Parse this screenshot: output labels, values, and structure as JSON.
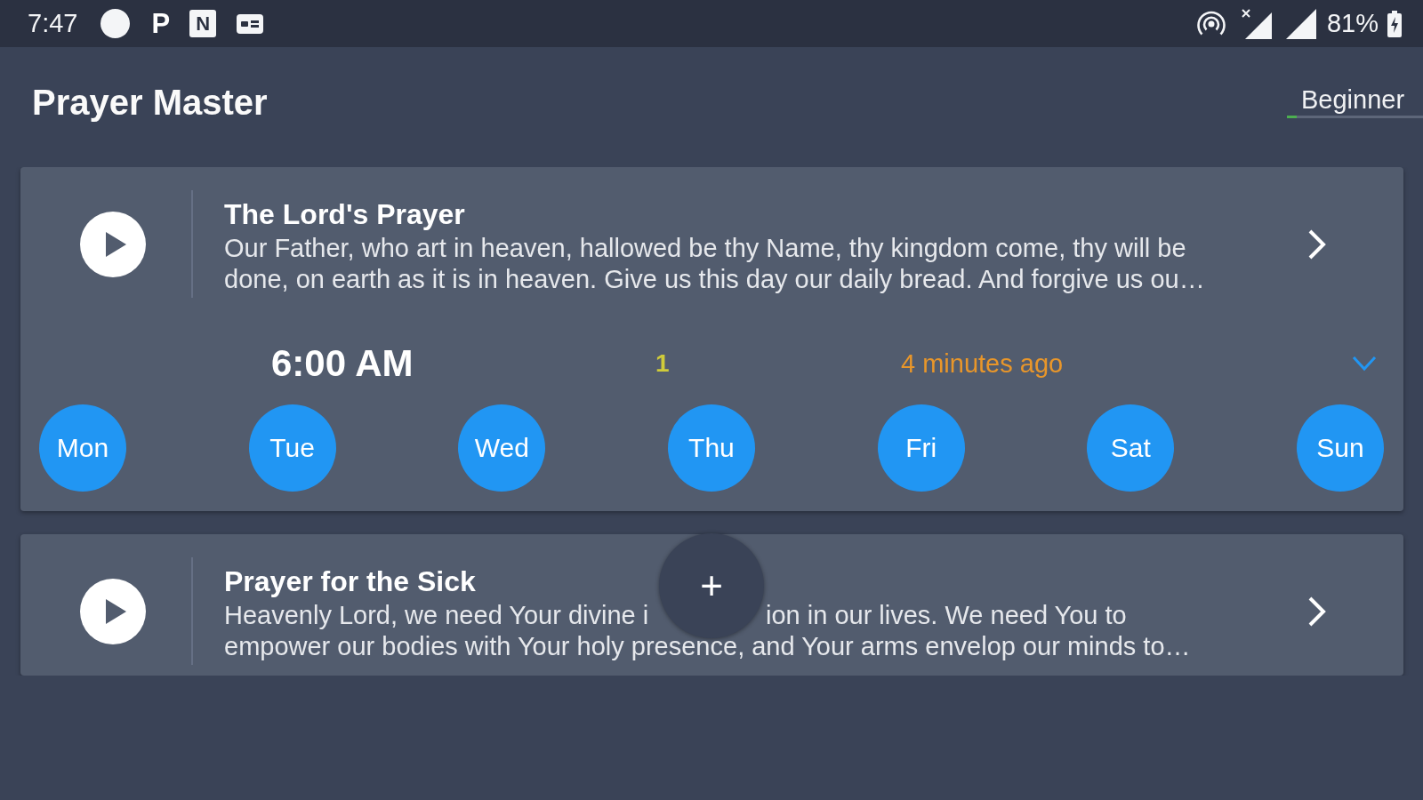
{
  "status_bar": {
    "time": "7:47",
    "notifications": [
      {
        "kind": "letter",
        "text": "P"
      },
      {
        "kind": "tile",
        "text": "N"
      }
    ],
    "battery": "81%"
  },
  "app_bar": {
    "title": "Prayer Master",
    "level_tab": {
      "label": "Beginner",
      "level": 0.07
    }
  },
  "prayers": [
    {
      "title": "The Lord's Prayer",
      "description_lines": [
        [
          "Our Father, who art in heaven, hallowed be thy Name, thy kingdom come, thy will be"
        ],
        [
          "done, on earth as it is in heaven. Give us this day our daily bread. And forgive us ou…"
        ]
      ],
      "schedule": {
        "time": "6:00 AM",
        "count": "1",
        "last_prayed": "4 minutes ago",
        "days": [
          {
            "label": "Mon",
            "selected": true
          },
          {
            "label": "Tue",
            "selected": true
          },
          {
            "label": "Wed",
            "selected": true
          },
          {
            "label": "Thu",
            "selected": true
          },
          {
            "label": "Fri",
            "selected": true
          },
          {
            "label": "Sat",
            "selected": true
          },
          {
            "label": "Sun",
            "selected": true
          }
        ]
      }
    },
    {
      "title": "Prayer for the Sick",
      "description_lines": [
        [
          "Heavenly Lord, we need Your divine i",
          "ion in our lives. We need You to"
        ],
        [
          "empower our bodies with Your holy presence, and Your arms envelop our minds to…"
        ]
      ]
    }
  ],
  "fab": {
    "label": "+"
  }
}
